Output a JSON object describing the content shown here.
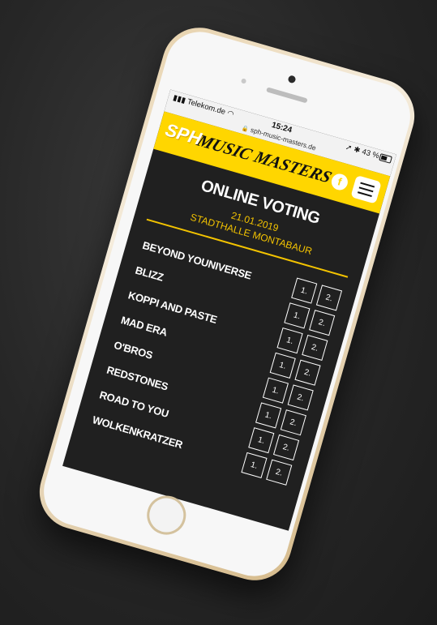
{
  "status": {
    "carrier": "Telekom.de",
    "time": "15:24",
    "url": "sph-music-masters.de",
    "battery": "43 %"
  },
  "header": {
    "logo_prefix": "SPH",
    "logo_title": "MUSIC MASTERS",
    "facebook_icon": "f"
  },
  "main": {
    "title": "ONLINE VOTING",
    "date": "21.01.2019",
    "venue": "STADTHALLE MONTABAUR"
  },
  "vote_labels": {
    "first": "1.",
    "second": "2."
  },
  "bands": [
    {
      "name": "BEYOND YOUNIVERSE"
    },
    {
      "name": "BLIZZ"
    },
    {
      "name": "KOPPI AND PASTE"
    },
    {
      "name": "MAD ERA"
    },
    {
      "name": "O'BROS"
    },
    {
      "name": "REDSTONES"
    },
    {
      "name": "ROAD TO YOU"
    },
    {
      "name": "WOLKENKRATZER"
    }
  ],
  "colors": {
    "accent": "#ffd600",
    "background": "#202020"
  }
}
